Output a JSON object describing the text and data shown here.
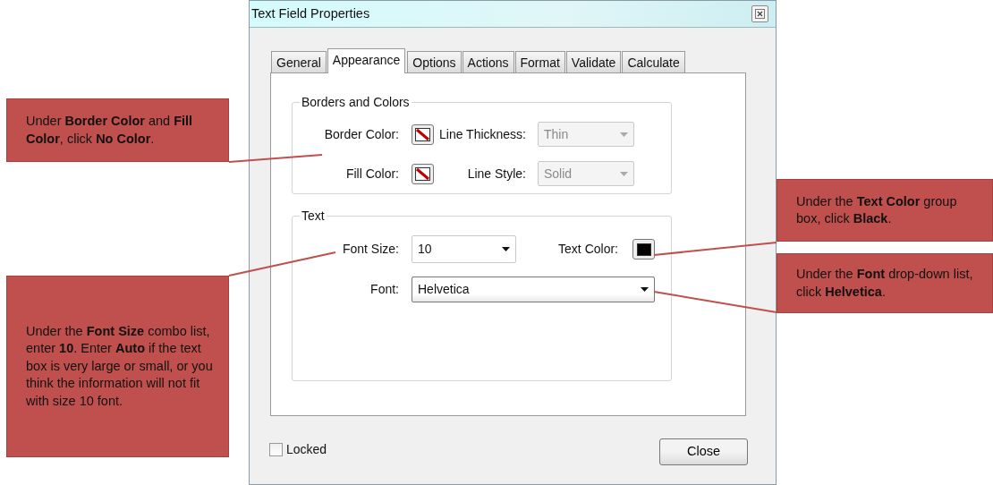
{
  "window": {
    "title": "Text Field Properties"
  },
  "tabs": [
    {
      "label": "General",
      "selected": false
    },
    {
      "label": "Appearance",
      "selected": true
    },
    {
      "label": "Options",
      "selected": false
    },
    {
      "label": "Actions",
      "selected": false
    },
    {
      "label": "Format",
      "selected": false
    },
    {
      "label": "Validate",
      "selected": false
    },
    {
      "label": "Calculate",
      "selected": false
    }
  ],
  "borders_and_colors": {
    "title": "Borders and Colors",
    "border_color": {
      "label": "Border Color:",
      "no_color": true
    },
    "fill_color": {
      "label": "Fill Color:",
      "no_color": true
    },
    "line_thickness": {
      "label": "Line Thickness:",
      "value": "Thin",
      "disabled": true
    },
    "line_style": {
      "label": "Line Style:",
      "value": "Solid",
      "disabled": true
    }
  },
  "text_group": {
    "title": "Text",
    "font_size": {
      "label": "Font Size:",
      "value": "10"
    },
    "text_color": {
      "label": "Text Color:",
      "color": "#000000"
    },
    "font": {
      "label": "Font:",
      "value": "Helvetica"
    }
  },
  "locked": {
    "label": "Locked",
    "checked": false
  },
  "buttons": [
    "Close"
  ],
  "callouts": [
    {
      "text": "Under **Border Color** and **Fill Color**, click **No Color**."
    },
    {
      "text": "Under the **Font Size** combo list, enter **10**. Enter **Auto** if the text box is very large or small, or you think the information will not fit with size 10 font."
    },
    {
      "text": "Under the **Text Color** group box, click **Black**."
    },
    {
      "text": "Under the **Font** drop-down list, click **Helvetica**."
    }
  ]
}
